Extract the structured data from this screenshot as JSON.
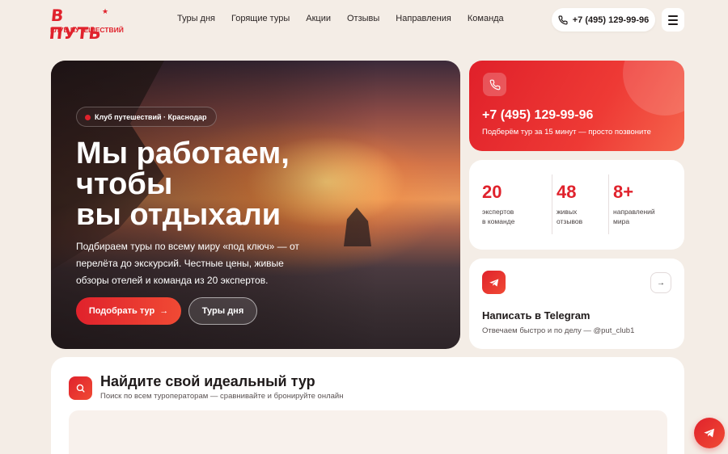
{
  "logo": {
    "top": "В ПУТЬ",
    "bottom": "КЛУБ ПУТЕШЕСТВИЙ"
  },
  "nav": {
    "items": [
      "Туры дня",
      "Горящие туры",
      "Акции",
      "Отзывы",
      "Направления",
      "Команда"
    ]
  },
  "header": {
    "phone": "+7 (495) 129-99-96"
  },
  "hero": {
    "badge": "Клуб путешествий · Краснодар",
    "title_line1": "Мы работаем,",
    "title_line2": "чтобы",
    "title_line3": "вы отдыхали",
    "text": "Подбираем туры по всему миру «под ключ» — от перелёта до экскурсий. Честные цены, живые обзоры отелей и команда из 20 экспертов.",
    "primary_button": "Подобрать тур",
    "secondary_button": "Туры дня"
  },
  "phone_card": {
    "number": "+7 (495) 129-99-96",
    "subtitle": "Подберём тур за 15 минут — просто позвоните"
  },
  "stats": [
    {
      "value": "20",
      "label": "экспертов\nв команде"
    },
    {
      "value": "48",
      "label": "живых\nотзывов"
    },
    {
      "value": "8+",
      "label": "направлений\nмира"
    }
  ],
  "telegram_card": {
    "title": "Написать в Telegram",
    "subtitle": "Отвечаем быстро и по делу — @put_club1"
  },
  "search_section": {
    "title": "Найдите свой идеальный тур",
    "subtitle": "Поиск по всем туроператорам — сравнивайте и бронируйте онлайн"
  },
  "colors": {
    "accent": "#e0222c",
    "background": "#f4ede6"
  }
}
